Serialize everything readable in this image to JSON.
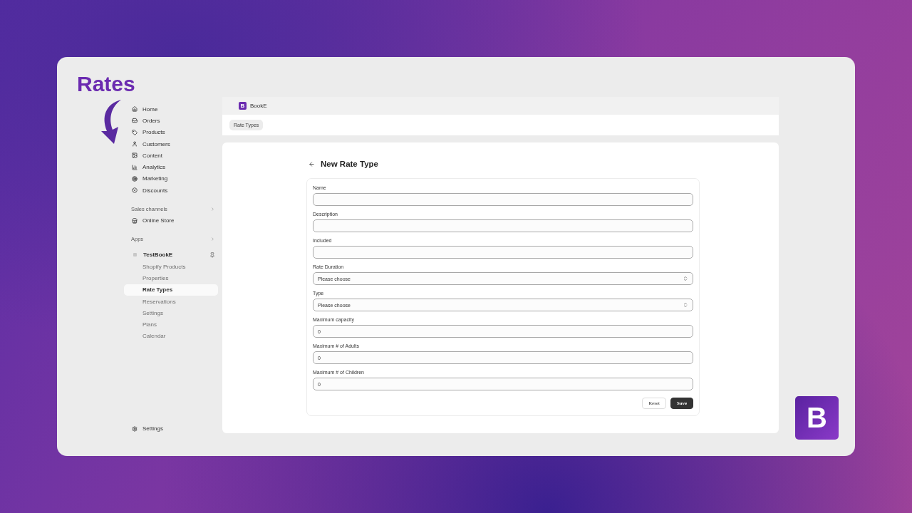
{
  "heading": "Rates",
  "sidebar": {
    "items": [
      {
        "label": "Home",
        "selected": false
      },
      {
        "label": "Orders",
        "selected": false
      },
      {
        "label": "Products",
        "selected": false
      },
      {
        "label": "Customers",
        "selected": false
      },
      {
        "label": "Content",
        "selected": false
      },
      {
        "label": "Analytics",
        "selected": false
      },
      {
        "label": "Marketing",
        "selected": false
      },
      {
        "label": "Discounts",
        "selected": false
      }
    ],
    "sales_channels": {
      "title": "Sales channels",
      "items": [
        {
          "label": "Online Store",
          "selected": false
        }
      ]
    },
    "apps": {
      "title": "Apps",
      "app": {
        "label": "TestBookE",
        "children": [
          {
            "label": "Shopify Products",
            "selected": false
          },
          {
            "label": "Properties",
            "selected": false
          },
          {
            "label": "Rate Types",
            "selected": true
          },
          {
            "label": "Reservations",
            "selected": false
          },
          {
            "label": "Settings",
            "selected": false
          },
          {
            "label": "Plans",
            "selected": false
          },
          {
            "label": "Calendar",
            "selected": false
          }
        ]
      }
    },
    "settings": "Settings"
  },
  "app_bar": {
    "logo_letter": "B",
    "title": "BookE"
  },
  "breadcrumb": "Rate Types",
  "form": {
    "title": "New Rate Type",
    "fields": [
      {
        "label": "Name",
        "kind": "text"
      },
      {
        "label": "Description",
        "kind": "text"
      },
      {
        "label": "Included",
        "kind": "text"
      },
      {
        "label": "Rate Duration",
        "kind": "select",
        "value": "Please choose"
      },
      {
        "label": "Type",
        "kind": "select",
        "value": "Please choose"
      },
      {
        "label": "Maximum capacity",
        "kind": "text",
        "value": "0"
      },
      {
        "label": "Maximum # of Adults",
        "kind": "text",
        "value": "0"
      },
      {
        "label": "Maximum # of Children",
        "kind": "text",
        "value": "0"
      }
    ],
    "buttons": [
      {
        "label": "Reset",
        "kind": "secondary"
      },
      {
        "label": "Save",
        "kind": "primary"
      }
    ]
  },
  "brand_logo": {
    "letter": "B"
  }
}
